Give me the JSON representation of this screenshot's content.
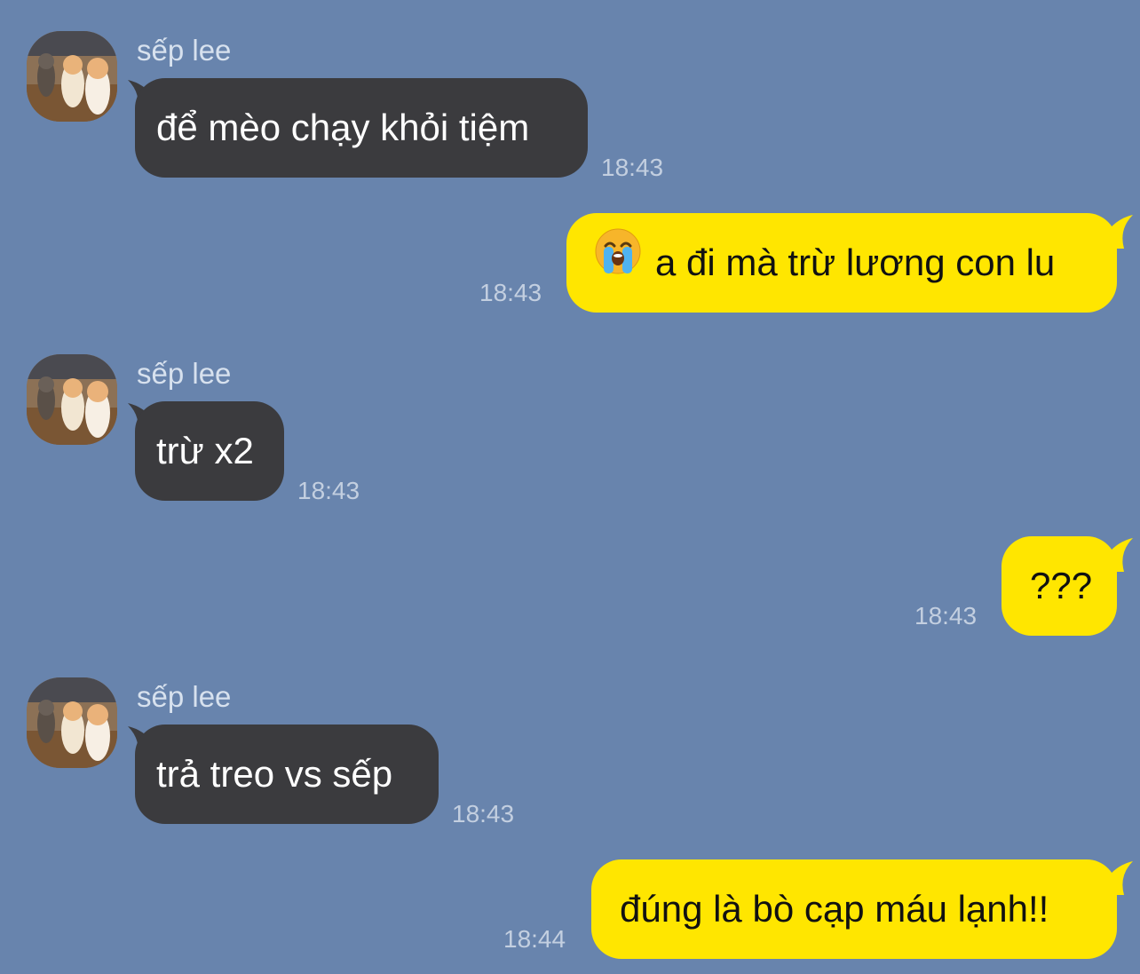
{
  "colors": {
    "background": "#6884ad",
    "incoming_bubble": "#3b3b3e",
    "outgoing_bubble": "#ffe600",
    "timestamp": "#c3cfe0",
    "sender_name": "#d7e1ee"
  },
  "messages": [
    {
      "direction": "incoming",
      "sender": "sếp lee",
      "text": "để mèo chạy khỏi tiệm",
      "time": "18:43",
      "avatar_icon": "cats-avatar-icon"
    },
    {
      "direction": "outgoing",
      "emoji": "😭",
      "emoji_icon": "loudly-crying-face-icon",
      "text": "a đi mà trừ lương con lu",
      "time": "18:43"
    },
    {
      "direction": "incoming",
      "sender": "sếp lee",
      "text": "trừ x2",
      "time": "18:43",
      "avatar_icon": "cats-avatar-icon"
    },
    {
      "direction": "outgoing",
      "text": "???",
      "time": "18:43"
    },
    {
      "direction": "incoming",
      "sender": "sếp lee",
      "text": "trả treo vs sếp",
      "time": "18:43",
      "avatar_icon": "cats-avatar-icon"
    },
    {
      "direction": "outgoing",
      "text": "đúng là bò cạp máu lạnh!!",
      "time": "18:44"
    }
  ]
}
